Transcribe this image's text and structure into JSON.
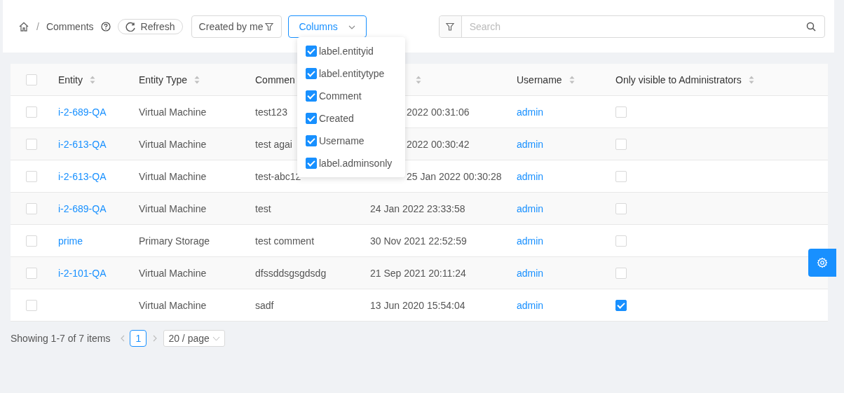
{
  "breadcrumb": {
    "separator": "/",
    "title": "Comments"
  },
  "toolbar": {
    "refresh": "Refresh",
    "filter": "Created by me",
    "columns": "Columns"
  },
  "search": {
    "placeholder": "Search"
  },
  "columns_menu": [
    {
      "label": "label.entityid",
      "checked": true
    },
    {
      "label": "label.entitytype",
      "checked": true
    },
    {
      "label": "Comment",
      "checked": true
    },
    {
      "label": "Created",
      "checked": true
    },
    {
      "label": "Username",
      "checked": true
    },
    {
      "label": "label.adminsonly",
      "checked": true
    }
  ],
  "table": {
    "all_selected": false,
    "columns": [
      {
        "label": "Entity",
        "sortable": true
      },
      {
        "label": "Entity Type",
        "sortable": true
      },
      {
        "label": "Commen"
      },
      {
        "sortable": true
      },
      {
        "label": "Username",
        "sortable": true
      },
      {
        "label": "Only visible to Administrators",
        "sortable": true
      }
    ],
    "rows": [
      {
        "selected": false,
        "entity": "i-2-689-QA",
        "type": "Virtual Machine",
        "comment": "test123",
        "created": "2022 00:31:06",
        "username": "admin",
        "admins_only": false
      },
      {
        "selected": false,
        "entity": "i-2-613-QA",
        "type": "Virtual Machine",
        "comment": "test agai",
        "created": "2022 00:30:42",
        "username": "admin",
        "admins_only": false
      },
      {
        "selected": false,
        "entity": "i-2-613-QA",
        "type": "Virtual Machine",
        "comment": "test-abc12",
        "created": "25 Jan 2022 00:30:28",
        "username": "admin",
        "admins_only": false
      },
      {
        "selected": false,
        "entity": "i-2-689-QA",
        "type": "Virtual Machine",
        "comment": "test",
        "created": "24 Jan 2022 23:33:58",
        "username": "admin",
        "admins_only": false
      },
      {
        "selected": false,
        "entity": "prime",
        "type": "Primary Storage",
        "comment": "test comment",
        "created": "30 Nov 2021 22:52:59",
        "username": "admin",
        "admins_only": false
      },
      {
        "selected": false,
        "entity": "i-2-101-QA",
        "type": "Virtual Machine",
        "comment": "dfssddsgsgdsdg",
        "created": "21 Sep 2021 20:11:24",
        "username": "admin",
        "admins_only": false
      },
      {
        "selected": false,
        "type": "Virtual Machine",
        "comment": "sadf",
        "created": "13 Jun 2020 15:54:04",
        "username": "admin",
        "admins_only": true
      }
    ]
  },
  "pagination": {
    "summary": "Showing 1-7 of 7 items",
    "pages": [
      {
        "label": "1",
        "selected": true
      }
    ],
    "page_size": "20 / page"
  }
}
